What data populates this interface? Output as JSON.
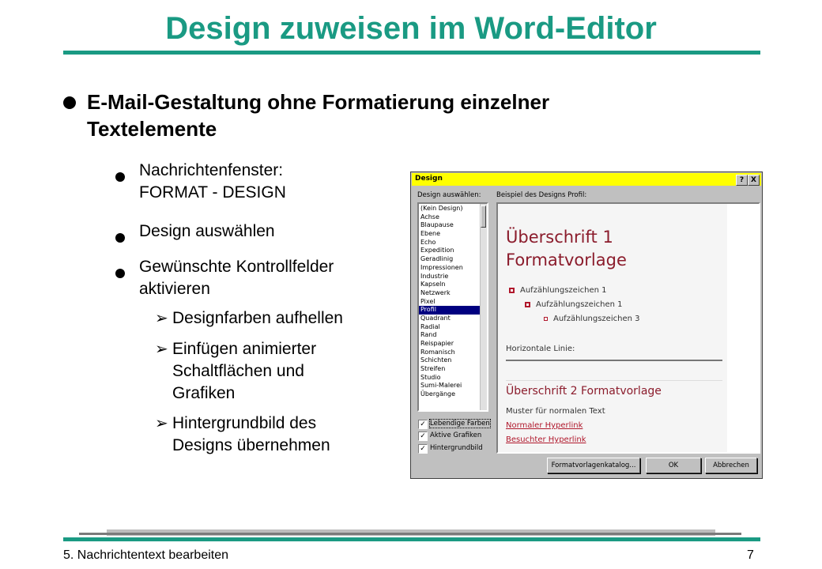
{
  "slide": {
    "title": "Design zuweisen im Word-Editor",
    "bullet_main": "E-Mail-Gestaltung ohne Formatierung einzelner Textelemente",
    "sub1_line1": "Nachrichtenfenster:",
    "sub1_line2": "FORMAT - DESIGN",
    "sub2": "Design auswählen",
    "sub3_line1": "Gewünschte Kontrollfelder",
    "sub3_line2": "aktivieren",
    "opt1": "Designfarben aufhellen",
    "opt2_line1": "Einfügen animierter",
    "opt2_line2": "Schaltflächen und",
    "opt2_line3": "Grafiken",
    "opt3_line1": "Hintergrundbild des",
    "opt3_line2": "Designs übernehmen",
    "arrow_glyph": "Ø"
  },
  "dialog": {
    "title": "Design",
    "help_btn": "?",
    "close_btn": "X",
    "select_label": "Design auswählen:",
    "preview_label": "Beispiel des Designs Profil:",
    "designs": [
      "(Kein Design)",
      "Achse",
      "Blaupause",
      "Ebene",
      "Echo",
      "Expedition",
      "Geradlinig",
      "Impressionen",
      "Industrie",
      "Kapseln",
      "Netzwerk",
      "Pixel",
      "Profil",
      "Quadrant",
      "Radial",
      "Rand",
      "Reispapier",
      "Romanisch",
      "Schichten",
      "Streifen",
      "Studio",
      "Sumi-Malerei",
      "Übergänge"
    ],
    "selected": "Profil",
    "checkboxes": [
      {
        "label": "Lebendige Farben",
        "checked": true
      },
      {
        "label": "Aktive Grafiken",
        "checked": true
      },
      {
        "label": "Hintergrundbild",
        "checked": true
      }
    ],
    "check_mark": "✓",
    "preview": {
      "h1_line1": "Überschrift 1",
      "h1_line2": "Formatvorlage",
      "bullet1": "Aufzählungszeichen 1",
      "bullet2": "Aufzählungszeichen 1",
      "bullet3": "Aufzählungszeichen 3",
      "hr_label": "Horizontale Linie:",
      "h2": "Überschrift 2 Formatvorlage",
      "body": "Muster für normalen Text",
      "link_normal": "Normaler Hyperlink",
      "link_visited": "Besuchter Hyperlink",
      "accent": "#8b1c2c"
    },
    "buttons": {
      "catalog": "Formatvorlagenkatalog...",
      "ok": "OK",
      "cancel": "Abbrechen"
    },
    "title_bg": "#ffff00"
  },
  "footer": {
    "left": "5. Nachrichtentext bearbeiten",
    "page": "7"
  },
  "colors": {
    "accent": "#1a9a83"
  }
}
